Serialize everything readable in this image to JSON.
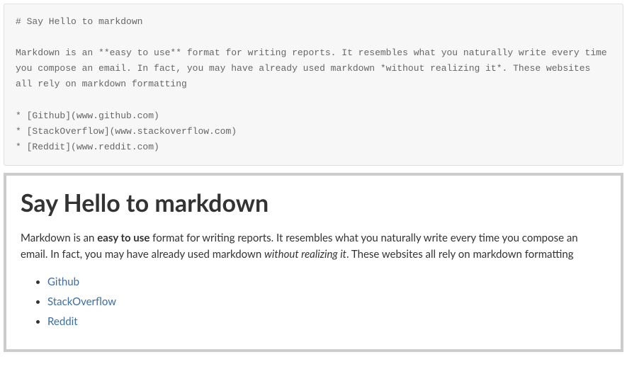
{
  "source": {
    "line1": "# Say Hello to markdown",
    "line2": "",
    "line3": "Markdown is an **easy to use** format for writing reports. It resembles what you naturally write every time you compose an email. In fact, you may have already used markdown *without realizing it*. These websites all rely on markdown formatting",
    "line4": "",
    "line5": "* [Github](www.github.com)",
    "line6": "* [StackOverflow](www.stackoverflow.com)",
    "line7": "* [Reddit](www.reddit.com)"
  },
  "rendered": {
    "heading": "Say Hello to markdown",
    "para_prefix": "Markdown is an ",
    "para_bold": "easy to use",
    "para_mid1": " format for writing reports. It resembles what you naturally write every time you compose an email. In fact, you may have already used markdown ",
    "para_italic": "without realizing it",
    "para_suffix": ". These websites all rely on markdown formatting",
    "links": {
      "0": "Github",
      "1": "StackOverflow",
      "2": "Reddit"
    }
  }
}
